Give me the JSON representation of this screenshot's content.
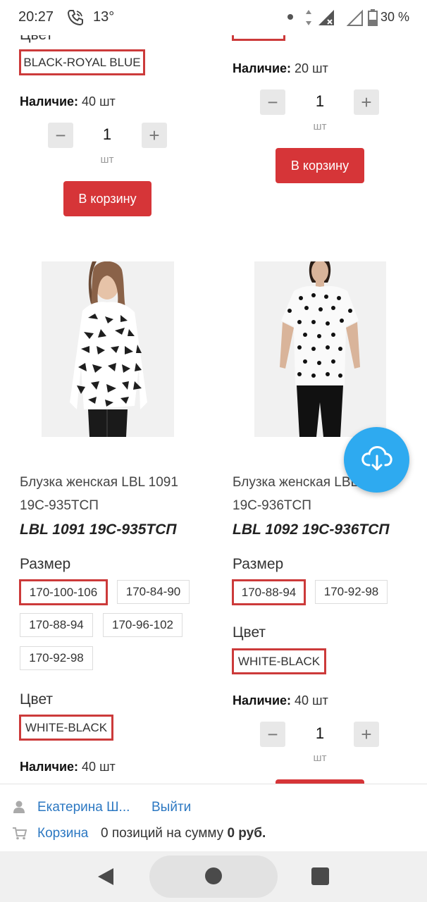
{
  "status_bar": {
    "time": "20:27",
    "temperature": "13°",
    "battery": "30 %",
    "icons": [
      "wifi-call-icon",
      "dot-icon",
      "data-arrows-icon",
      "signal-icon",
      "signal-empty-icon",
      "battery-icon"
    ]
  },
  "top_left_product": {
    "color_label": "Цвет",
    "color_selected": "BLACK-ROYAL BLUE",
    "stock_label": "Наличие:",
    "stock_value": "40 шт",
    "qty_minus": "−",
    "qty_value": "1",
    "qty_plus": "+",
    "qty_unit": "шт",
    "cart_button": "В корзину"
  },
  "top_right_product": {
    "stock_label": "Наличие:",
    "stock_value": "20 шт",
    "qty_minus": "−",
    "qty_value": "1",
    "qty_plus": "+",
    "qty_unit": "шт",
    "cart_button": "В корзину"
  },
  "product_left": {
    "name_line1": "Блузка женская LBL 1091",
    "name_line2": "19С-935ТСП",
    "code": "LBL 1091 19С-935ТСП",
    "size_label": "Размер",
    "sizes": [
      "170-100-106",
      "170-84-90",
      "170-88-94",
      "170-96-102",
      "170-92-98"
    ],
    "size_selected": "170-100-106",
    "color_label": "Цвет",
    "color_selected": "WHITE-BLACK",
    "stock_label": "Наличие:",
    "stock_value": "40 шт"
  },
  "product_right": {
    "name_line1": "Блузка женская LBL 1092",
    "name_line2": "19С-936ТСП",
    "code": "LBL 1092 19С-936ТСП",
    "size_label": "Размер",
    "sizes": [
      "170-88-94",
      "170-92-98"
    ],
    "size_selected": "170-88-94",
    "color_label": "Цвет",
    "color_selected": "WHITE-BLACK",
    "stock_label": "Наличие:",
    "stock_value": "40 шт",
    "qty_minus": "−",
    "qty_value": "1",
    "qty_plus": "+",
    "qty_unit": "шт"
  },
  "user_panel": {
    "user_name": "Екатерина Ш...",
    "logout": "Выйти",
    "cart_link": "Корзина",
    "cart_summary": "0 позиций на сумму",
    "cart_total": "0 руб."
  },
  "colors": {
    "accent_red": "#d63538",
    "selected_border": "#cc3a3a",
    "link_blue": "#2c78c2",
    "fab_blue": "#2eaaf0"
  }
}
